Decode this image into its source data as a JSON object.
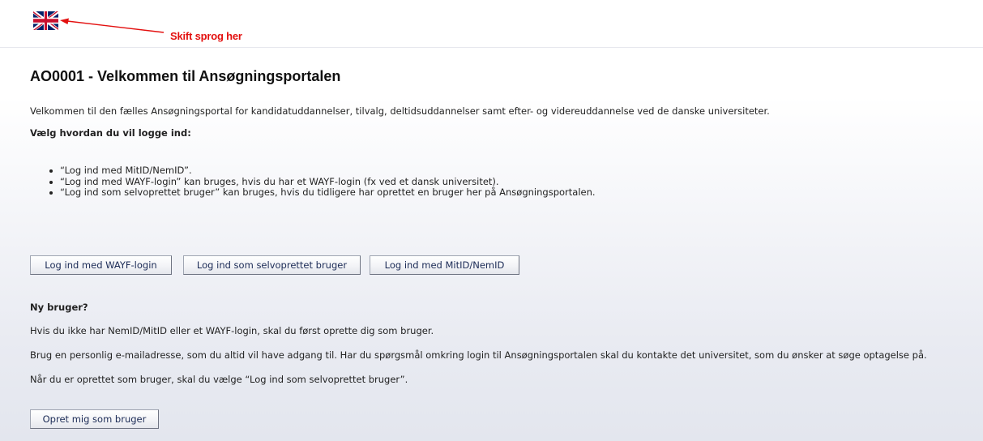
{
  "language": {
    "flag_icon": "uk-flag-icon",
    "annotation": "Skift sprog her",
    "annotation_color": "#e3100f"
  },
  "page": {
    "title": "AO0001 - Velkommen til Ansøgningsportalen",
    "intro": "Velkommen til den fælles Ansøgningsportal for kandidatuddannelser, tilvalg, deltidsuddannelser samt efter- og videreuddannelse ved de danske universiteter.",
    "choose_heading": "Vælg hvordan du vil logge ind:",
    "bullets": [
      "“Log ind med MitID/NemID”.",
      "“Log ind med WAYF-login” kan bruges, hvis du har et WAYF-login (fx ved et dansk universitet).",
      "“Log ind som selvoprettet bruger” kan bruges, hvis du tidligere har oprettet en bruger her på Ansøgningsportalen."
    ]
  },
  "login_buttons": {
    "wayf": "Log ind med WAYF-login",
    "self_created": "Log ind som selvoprettet bruger",
    "mitid": "Log ind med MitID/NemID"
  },
  "new_user": {
    "heading": "Ny bruger?",
    "line1": "Hvis du ikke har NemID/MitID eller et WAYF-login, skal du først oprette dig som bruger.",
    "line2": "Brug en personlig e-mailadresse, som du altid vil have adgang til. Har du spørgsmål omkring login til Ansøgningsportalen skal du kontakte det universitet, som du ønsker at søge optagelse på.",
    "line3": "Når du er oprettet som bruger, skal du vælge “Log ind som selvoprettet bruger”.",
    "create_button": "Opret mig som bruger"
  }
}
